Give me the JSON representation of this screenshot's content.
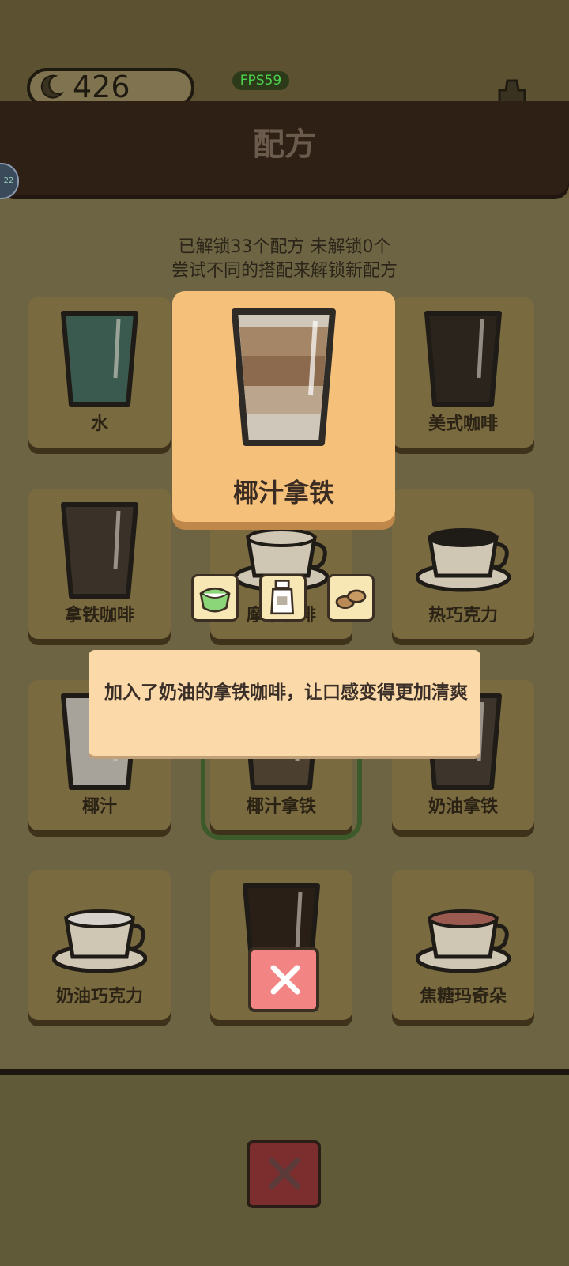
{
  "hud": {
    "coins": "426",
    "fps": "FPS59"
  },
  "panel": {
    "title": "配方",
    "badge": "22",
    "unlock_text": "已解锁33个配方  未解锁0个",
    "hint_text": "尝试不同的搭配来解锁新配方"
  },
  "recipes": [
    {
      "name": "水"
    },
    {
      "name": ""
    },
    {
      "name": "美式咖啡"
    },
    {
      "name": "拿铁咖啡"
    },
    {
      "name": "摩卡咖啡"
    },
    {
      "name": "热巧克力"
    },
    {
      "name": "椰汁"
    },
    {
      "name": "椰汁拿铁"
    },
    {
      "name": "奶油拿铁"
    },
    {
      "name": "奶油巧克力"
    },
    {
      "name": ""
    },
    {
      "name": "焦糖玛奇朵"
    }
  ],
  "modal": {
    "title": "椰汁拿铁",
    "description": "加入了奶油的拿铁咖啡，让口感变得更加清爽",
    "ingredients": [
      "coconut-icon",
      "milk-bottle-icon",
      "coffee-beans-icon"
    ]
  }
}
